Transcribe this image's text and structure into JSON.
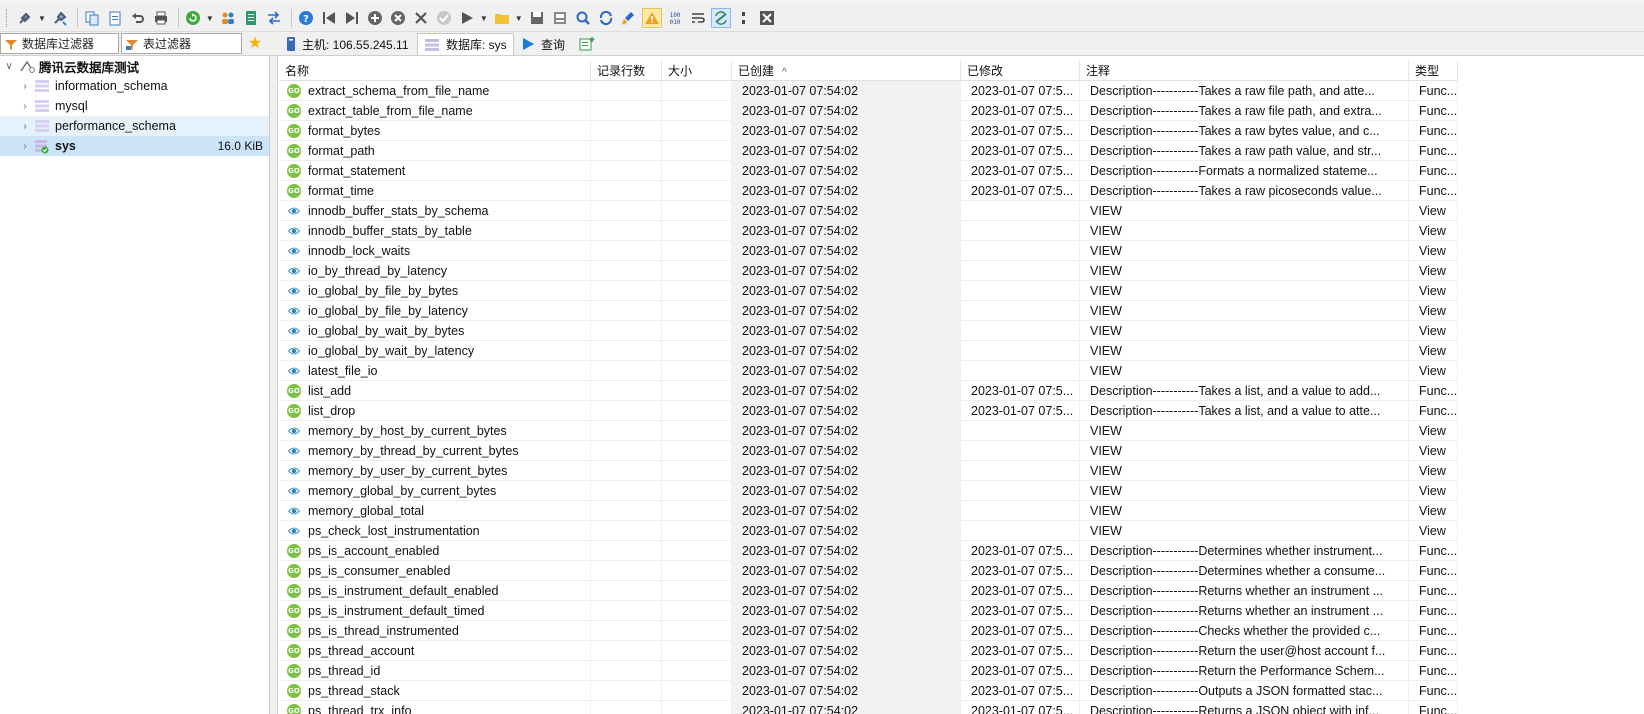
{
  "toolbar": {
    "icons": [
      "connect-icon",
      "disconnect-icon",
      "copy-icon",
      "paste-icon",
      "undo-icon",
      "print-icon",
      "refresh-icon",
      "users-icon",
      "export-icon",
      "transfer-icon",
      "help-icon",
      "first-icon",
      "last-icon",
      "add-icon",
      "delete-icon",
      "apply-icon",
      "cancel-icon",
      "run-icon",
      "folder-icon",
      "save-icon",
      "save-all-icon",
      "find-icon",
      "find-replace-icon",
      "clean-icon",
      "warning-icon",
      "binary-icon",
      "wrap-icon",
      "sync-icon",
      "split-icon",
      "close-icon"
    ]
  },
  "filters": {
    "database_filter": "数据库过滤器",
    "table_filter": "表过滤器"
  },
  "tabs": [
    {
      "label": "主机: 106.55.245.11"
    },
    {
      "label": "数据库: sys"
    },
    {
      "label": "查询"
    }
  ],
  "tree": {
    "root": "腾讯云数据库测试",
    "databases": [
      {
        "name": "information_schema",
        "size": ""
      },
      {
        "name": "mysql",
        "size": ""
      },
      {
        "name": "performance_schema",
        "size": ""
      },
      {
        "name": "sys",
        "size": "16.0 KiB"
      }
    ]
  },
  "grid": {
    "columns": {
      "name": "名称",
      "rows": "记录行数",
      "size": "大小",
      "created": "已创建",
      "modified": "已修改",
      "comment": "注释",
      "type": "类型"
    },
    "sort_indicator": "^",
    "rows": [
      {
        "icon": "function",
        "name": "extract_schema_from_file_name",
        "created": "2023-01-07 07:54:02",
        "modified": "2023-01-07 07:5...",
        "comment": "Description-----------Takes a raw file path, and atte...",
        "type": "Func..."
      },
      {
        "icon": "function",
        "name": "extract_table_from_file_name",
        "created": "2023-01-07 07:54:02",
        "modified": "2023-01-07 07:5...",
        "comment": "Description-----------Takes a raw file path, and extra...",
        "type": "Func..."
      },
      {
        "icon": "function",
        "name": "format_bytes",
        "created": "2023-01-07 07:54:02",
        "modified": "2023-01-07 07:5...",
        "comment": "Description-----------Takes a raw bytes value, and c...",
        "type": "Func..."
      },
      {
        "icon": "function",
        "name": "format_path",
        "created": "2023-01-07 07:54:02",
        "modified": "2023-01-07 07:5...",
        "comment": "Description-----------Takes a raw path value, and str...",
        "type": "Func..."
      },
      {
        "icon": "function",
        "name": "format_statement",
        "created": "2023-01-07 07:54:02",
        "modified": "2023-01-07 07:5...",
        "comment": "Description-----------Formats a normalized stateme...",
        "type": "Func..."
      },
      {
        "icon": "function",
        "name": "format_time",
        "created": "2023-01-07 07:54:02",
        "modified": "2023-01-07 07:5...",
        "comment": "Description-----------Takes a raw picoseconds value...",
        "type": "Func..."
      },
      {
        "icon": "view",
        "name": "innodb_buffer_stats_by_schema",
        "created": "2023-01-07 07:54:02",
        "modified": "",
        "comment": "VIEW",
        "type": "View"
      },
      {
        "icon": "view",
        "name": "innodb_buffer_stats_by_table",
        "created": "2023-01-07 07:54:02",
        "modified": "",
        "comment": "VIEW",
        "type": "View"
      },
      {
        "icon": "view",
        "name": "innodb_lock_waits",
        "created": "2023-01-07 07:54:02",
        "modified": "",
        "comment": "VIEW",
        "type": "View"
      },
      {
        "icon": "view",
        "name": "io_by_thread_by_latency",
        "created": "2023-01-07 07:54:02",
        "modified": "",
        "comment": "VIEW",
        "type": "View"
      },
      {
        "icon": "view",
        "name": "io_global_by_file_by_bytes",
        "created": "2023-01-07 07:54:02",
        "modified": "",
        "comment": "VIEW",
        "type": "View"
      },
      {
        "icon": "view",
        "name": "io_global_by_file_by_latency",
        "created": "2023-01-07 07:54:02",
        "modified": "",
        "comment": "VIEW",
        "type": "View"
      },
      {
        "icon": "view",
        "name": "io_global_by_wait_by_bytes",
        "created": "2023-01-07 07:54:02",
        "modified": "",
        "comment": "VIEW",
        "type": "View"
      },
      {
        "icon": "view",
        "name": "io_global_by_wait_by_latency",
        "created": "2023-01-07 07:54:02",
        "modified": "",
        "comment": "VIEW",
        "type": "View"
      },
      {
        "icon": "view",
        "name": "latest_file_io",
        "created": "2023-01-07 07:54:02",
        "modified": "",
        "comment": "VIEW",
        "type": "View"
      },
      {
        "icon": "function",
        "name": "list_add",
        "created": "2023-01-07 07:54:02",
        "modified": "2023-01-07 07:5...",
        "comment": "Description-----------Takes a list, and a value to add...",
        "type": "Func..."
      },
      {
        "icon": "function",
        "name": "list_drop",
        "created": "2023-01-07 07:54:02",
        "modified": "2023-01-07 07:5...",
        "comment": "Description-----------Takes a list, and a value to atte...",
        "type": "Func..."
      },
      {
        "icon": "view",
        "name": "memory_by_host_by_current_bytes",
        "created": "2023-01-07 07:54:02",
        "modified": "",
        "comment": "VIEW",
        "type": "View"
      },
      {
        "icon": "view",
        "name": "memory_by_thread_by_current_bytes",
        "created": "2023-01-07 07:54:02",
        "modified": "",
        "comment": "VIEW",
        "type": "View"
      },
      {
        "icon": "view",
        "name": "memory_by_user_by_current_bytes",
        "created": "2023-01-07 07:54:02",
        "modified": "",
        "comment": "VIEW",
        "type": "View"
      },
      {
        "icon": "view",
        "name": "memory_global_by_current_bytes",
        "created": "2023-01-07 07:54:02",
        "modified": "",
        "comment": "VIEW",
        "type": "View"
      },
      {
        "icon": "view",
        "name": "memory_global_total",
        "created": "2023-01-07 07:54:02",
        "modified": "",
        "comment": "VIEW",
        "type": "View"
      },
      {
        "icon": "view",
        "name": "ps_check_lost_instrumentation",
        "created": "2023-01-07 07:54:02",
        "modified": "",
        "comment": "VIEW",
        "type": "View"
      },
      {
        "icon": "function",
        "name": "ps_is_account_enabled",
        "created": "2023-01-07 07:54:02",
        "modified": "2023-01-07 07:5...",
        "comment": "Description-----------Determines whether instrument...",
        "type": "Func..."
      },
      {
        "icon": "function",
        "name": "ps_is_consumer_enabled",
        "created": "2023-01-07 07:54:02",
        "modified": "2023-01-07 07:5...",
        "comment": "Description-----------Determines whether a consume...",
        "type": "Func..."
      },
      {
        "icon": "function",
        "name": "ps_is_instrument_default_enabled",
        "created": "2023-01-07 07:54:02",
        "modified": "2023-01-07 07:5...",
        "comment": "Description-----------Returns whether an instrument ...",
        "type": "Func..."
      },
      {
        "icon": "function",
        "name": "ps_is_instrument_default_timed",
        "created": "2023-01-07 07:54:02",
        "modified": "2023-01-07 07:5...",
        "comment": "Description-----------Returns whether an instrument ...",
        "type": "Func..."
      },
      {
        "icon": "function",
        "name": "ps_is_thread_instrumented",
        "created": "2023-01-07 07:54:02",
        "modified": "2023-01-07 07:5...",
        "comment": "Description-----------Checks whether the provided c...",
        "type": "Func..."
      },
      {
        "icon": "function",
        "name": "ps_thread_account",
        "created": "2023-01-07 07:54:02",
        "modified": "2023-01-07 07:5...",
        "comment": "Description-----------Return the user@host account f...",
        "type": "Func..."
      },
      {
        "icon": "function",
        "name": "ps_thread_id",
        "created": "2023-01-07 07:54:02",
        "modified": "2023-01-07 07:5...",
        "comment": "Description-----------Return the Performance Schem...",
        "type": "Func..."
      },
      {
        "icon": "function",
        "name": "ps_thread_stack",
        "created": "2023-01-07 07:54:02",
        "modified": "2023-01-07 07:5...",
        "comment": "Description-----------Outputs a JSON formatted stac...",
        "type": "Func..."
      },
      {
        "icon": "function",
        "name": "ps_thread_trx_info",
        "created": "2023-01-07 07:54:02",
        "modified": "2023-01-07 07:5...",
        "comment": "Description-----------Returns a JSON object with inf...",
        "type": "Func..."
      }
    ]
  },
  "colors": {
    "selected_row": "#cce4f7",
    "hover_row": "#e5f1fb",
    "function_icon": "#7cc243",
    "view_icon": "#2a7fb8",
    "accent": "#1a6fd1"
  }
}
